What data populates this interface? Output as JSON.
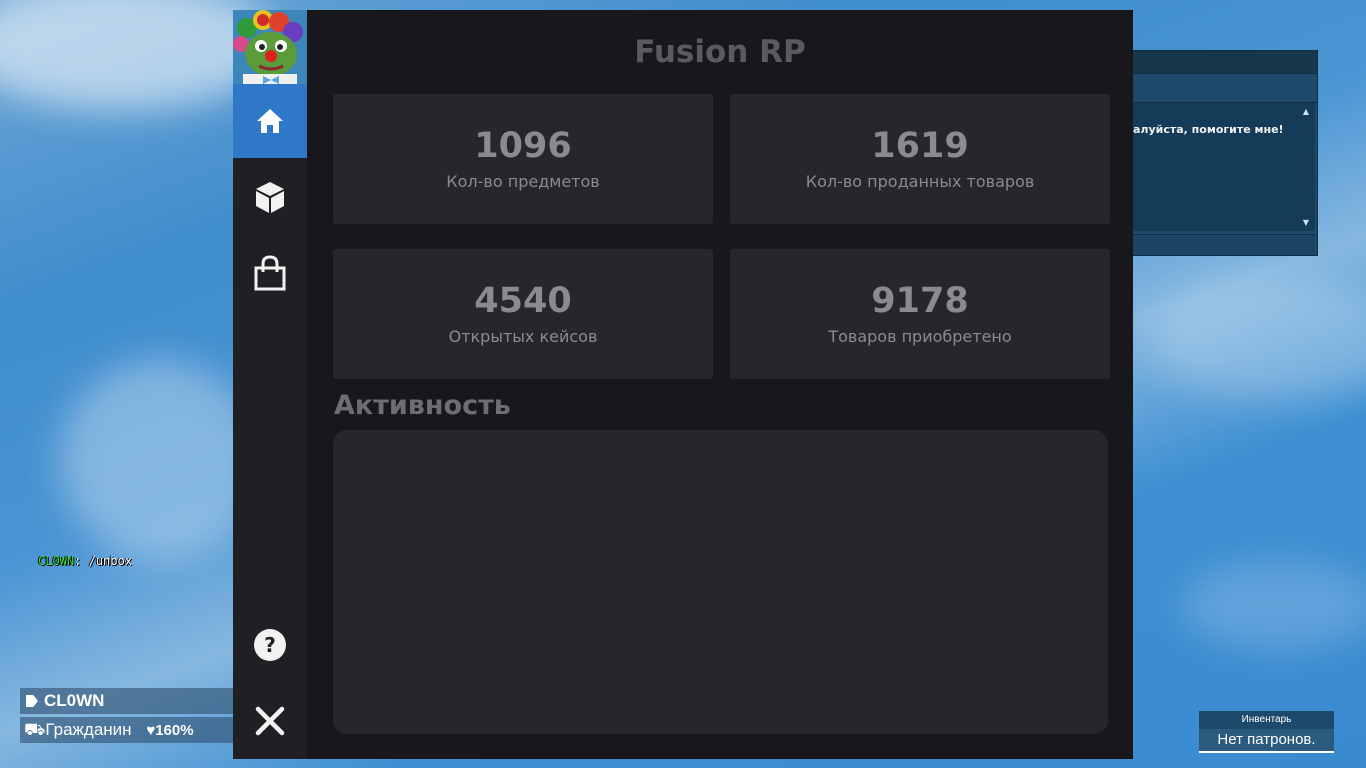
{
  "app": {
    "title": "Fusion RP"
  },
  "sidebar": {
    "items": [
      {
        "icon": "home-icon",
        "active": true
      },
      {
        "icon": "cube-icon",
        "active": false
      },
      {
        "icon": "shopping-bag-icon",
        "active": false
      }
    ],
    "help_icon": "question-circle-icon",
    "close_icon": "close-icon"
  },
  "stats": [
    {
      "value": "1096",
      "label": "Кол-во предметов"
    },
    {
      "value": "1619",
      "label": "Кол-во проданных товаров"
    },
    {
      "value": "4540",
      "label": "Открытых кейсов"
    },
    {
      "value": "9178",
      "label": "Товаров приобретено"
    }
  ],
  "activity": {
    "title": "Активность"
  },
  "chat_window": {
    "message": "алуйста, помогите мне!"
  },
  "chat": {
    "player": "CLOWN",
    "separator": ": ",
    "text": "/unbox"
  },
  "hud": {
    "name": "CL0WN",
    "job": "Гражданин",
    "health": "160%"
  },
  "ammo": {
    "title": "Инвентарь",
    "value": "Нет патронов."
  },
  "colors": {
    "accent": "#2f78c7",
    "panel": "#18181c",
    "card": "#26262b",
    "chat_name": "#39e04a"
  }
}
